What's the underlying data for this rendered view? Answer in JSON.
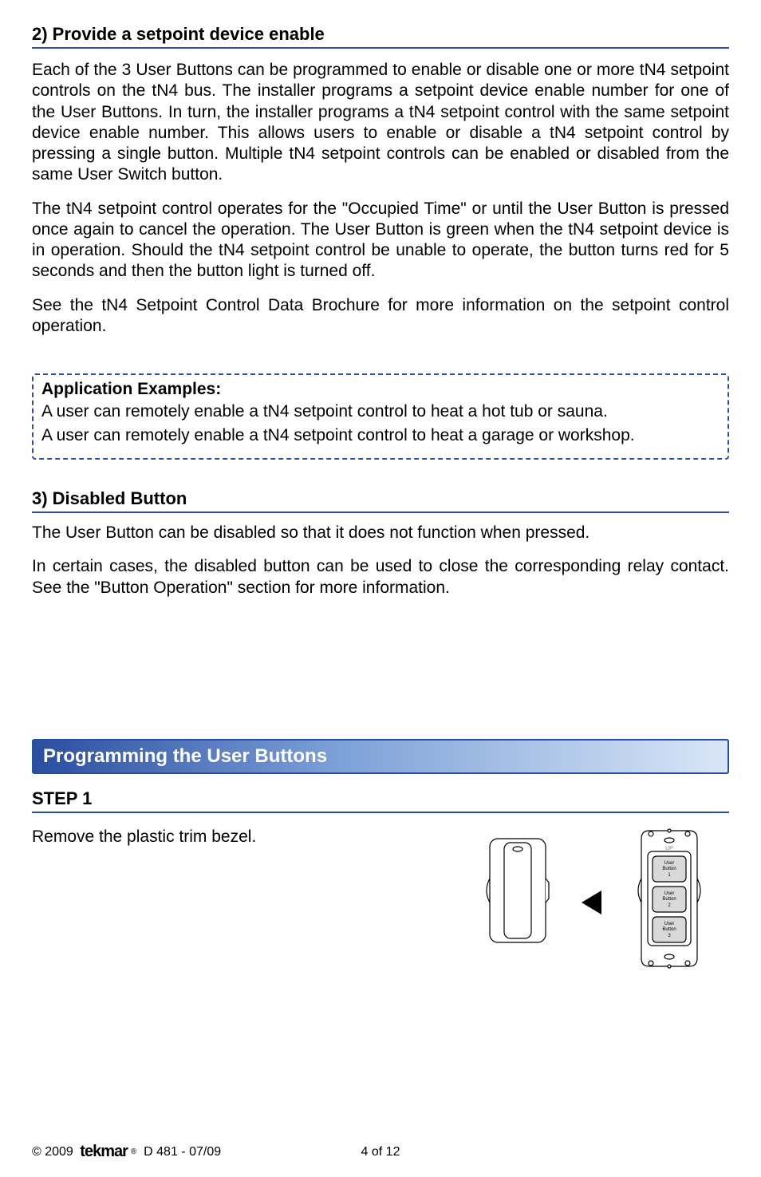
{
  "section2": {
    "heading": "2) Provide a setpoint device enable",
    "para1": "Each of the 3 User Buttons can be programmed to enable or disable one or more tN4 setpoint controls on the tN4 bus. The installer programs a setpoint device enable number for one of the User Buttons. In turn, the installer programs a tN4 setpoint control with the same setpoint device enable number. This allows users to enable or disable a tN4 setpoint control by pressing a single button. Multiple tN4 setpoint controls can be enabled or disabled from the same User Switch button.",
    "para2": "The tN4 setpoint control operates for the \"Occupied Time\" or until the User Button is pressed once again to cancel the operation. The User Button is green when the tN4 setpoint device is in operation. Should the tN4 setpoint control be unable to operate, the button turns red for 5 seconds and then the button light is turned off.",
    "para3": "See the tN4 Setpoint Control Data Brochure for more information on the setpoint control operation."
  },
  "examples": {
    "title": "Application Examples:",
    "line1": "A user can remotely enable a tN4 setpoint control to heat a hot tub or sauna.",
    "line2": "A user can remotely enable a tN4 setpoint control to heat a garage or workshop."
  },
  "section3": {
    "heading": "3) Disabled Button",
    "para1": "The User Button can be disabled so that it does not function when pressed.",
    "para2": "In certain cases, the disabled button can be used to close the corresponding relay contact. See the \"Button Operation\" section for more information."
  },
  "banner": {
    "title": "Programming the User Buttons"
  },
  "step1": {
    "heading": "STEP 1",
    "text": "Remove the plastic trim bezel."
  },
  "diagram": {
    "up_label": "UP",
    "btn1_line1": "User",
    "btn1_line2": "Button",
    "btn1_line3": "1",
    "btn2_line1": "User",
    "btn2_line2": "Button",
    "btn2_line3": "2",
    "btn3_line1": "User",
    "btn3_line2": "Button",
    "btn3_line3": "3"
  },
  "footer": {
    "copyright": "© 2009",
    "brand": "tekmar",
    "reg": "®",
    "docref": "D 481 - 07/09",
    "pagenum": "4 of 12"
  }
}
